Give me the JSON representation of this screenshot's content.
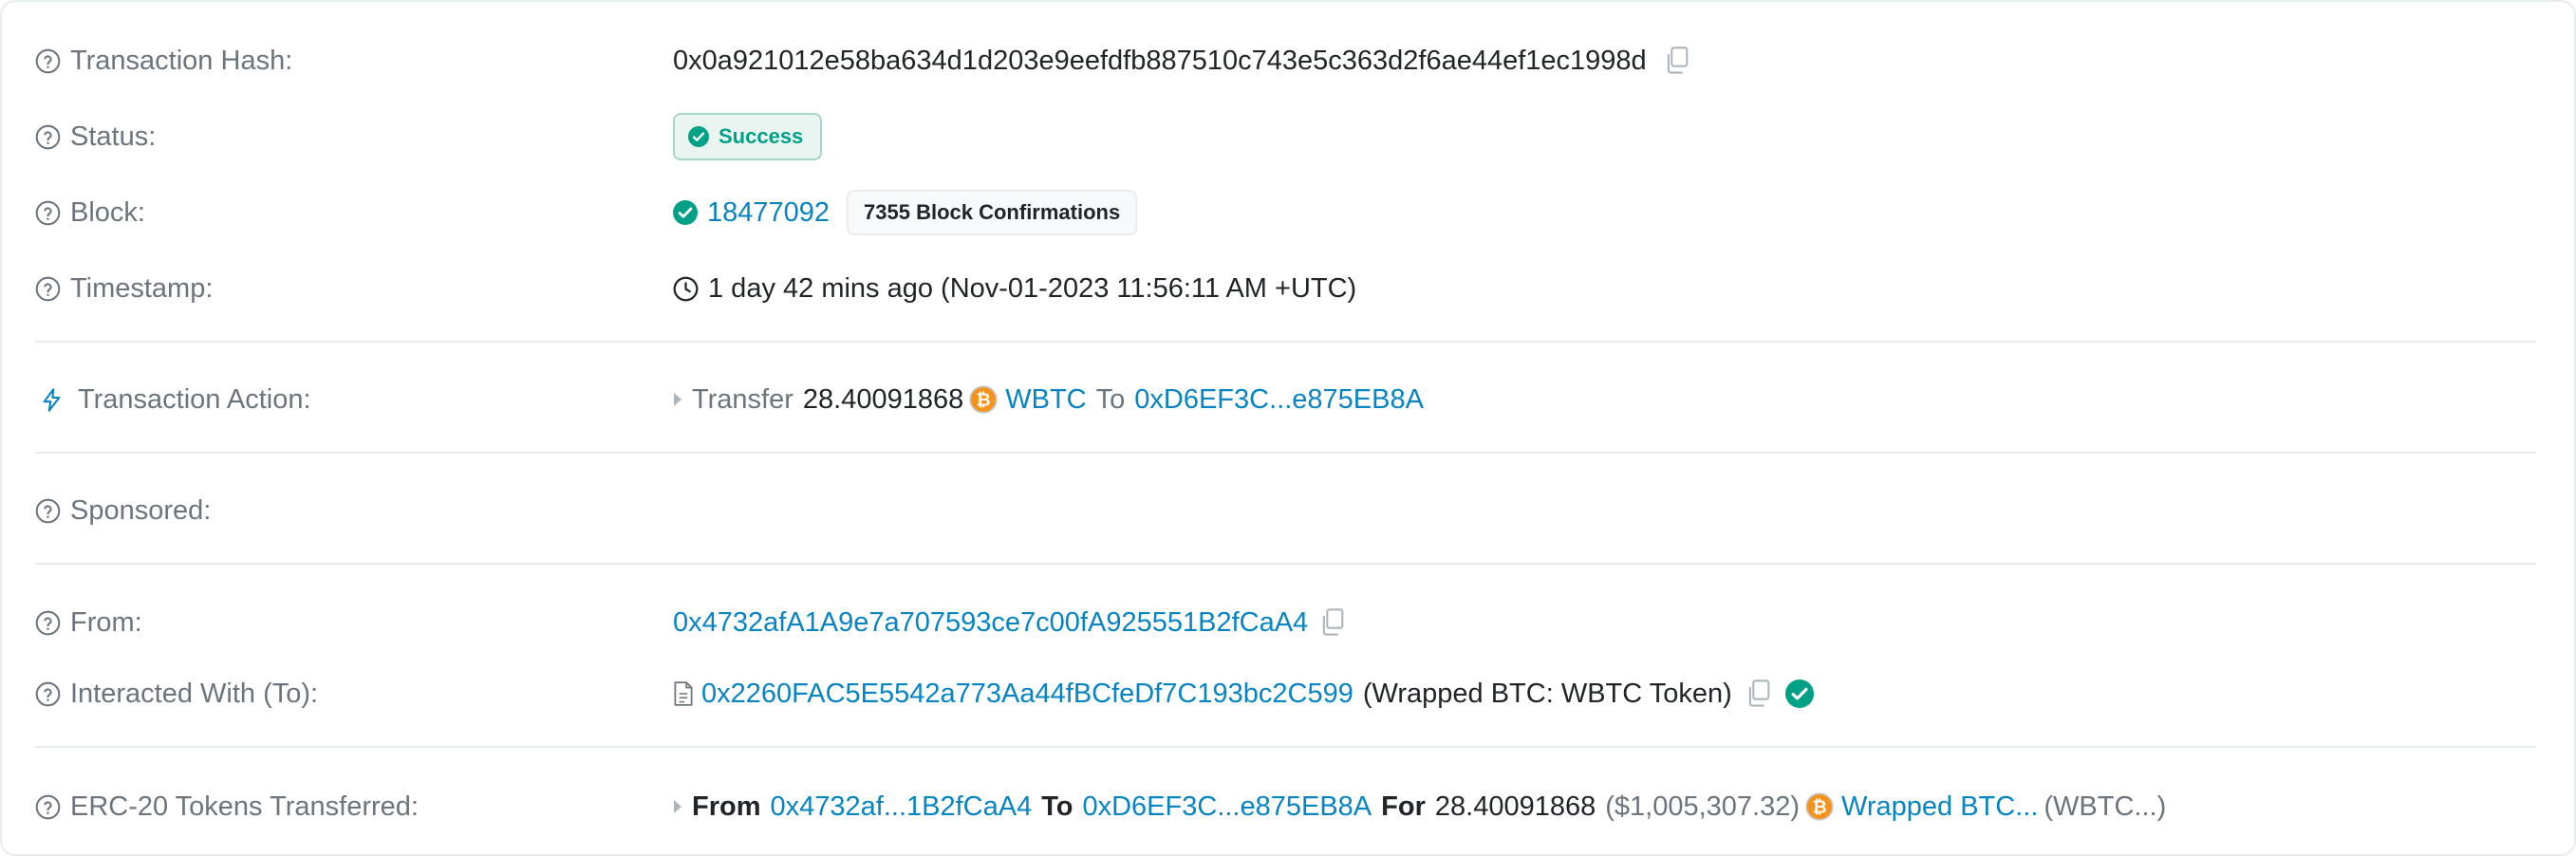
{
  "rows": {
    "hash": {
      "label": "Transaction Hash:",
      "value": "0x0a921012e58ba634d1d203e9eefdfb887510c743e5c363d2f6ae44ef1ec1998d"
    },
    "status": {
      "label": "Status:",
      "badge": "Success"
    },
    "block": {
      "label": "Block:",
      "number": "18477092",
      "confirmations": "7355 Block Confirmations"
    },
    "timestamp": {
      "label": "Timestamp:",
      "value": "1 day 42 mins ago (Nov-01-2023 11:56:11 AM +UTC)"
    },
    "action": {
      "label": "Transaction Action:",
      "verb": "Transfer",
      "amount": "28.40091868",
      "token": "WBTC",
      "to_word": "To",
      "to_address": "0xD6EF3C...e875EB8A"
    },
    "sponsored": {
      "label": "Sponsored:"
    },
    "from": {
      "label": "From:",
      "address": "0x4732afA1A9e7a707593ce7c00fA925551B2fCaA4"
    },
    "interacted": {
      "label": "Interacted With (To):",
      "address": "0x2260FAC5E5542a773Aa44fBCfeDf7C193bc2C599",
      "name": "(Wrapped BTC: WBTC Token)"
    },
    "erc20": {
      "label": "ERC-20 Tokens Transferred:",
      "from_word": "From",
      "from_address": "0x4732af...1B2fCaA4",
      "to_word": "To",
      "to_address": "0xD6EF3C...e875EB8A",
      "for_word": "For",
      "amount": "28.40091868",
      "usd": "($1,005,307.32)",
      "token_name": "Wrapped BTC...",
      "token_symbol": "(WBTC...)"
    }
  },
  "colors": {
    "link": "#0784c3",
    "success": "#00a186",
    "muted": "#6c757d",
    "btc": "#f7931a"
  }
}
